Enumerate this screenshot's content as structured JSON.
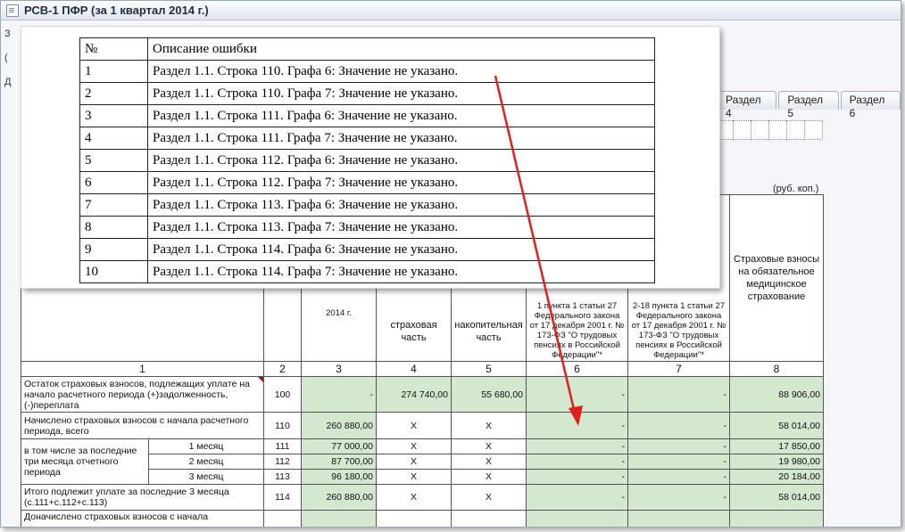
{
  "window": {
    "title": "РСВ-1 ПФР (за 1 квартал 2014 г.)",
    "side_letters": [
      "З",
      "(",
      "Д"
    ]
  },
  "tabs": [
    "Раздел 4",
    "Раздел 5",
    "Раздел 6"
  ],
  "units_label": "(руб. коп.)",
  "table": {
    "headers": {
      "col3": "2014 г.",
      "col4": "страховая часть",
      "col5": "накопительная часть",
      "col6": "1 пункта 1 статьи 27 Федерального закона от 17 декабря 2001 г. № 173-ФЗ \"О трудовых пенсиях в Российской Федерации\"*",
      "col7": "2-18 пункта 1 статьи 27 Федерального закона от 17 декабря 2001 г. № 173-ФЗ \"О трудовых пенсиях в Российской Федерации\"*",
      "col8": "Страховые взносы на обязательное медицинское страхование"
    },
    "col_numbers": [
      "1",
      "2",
      "3",
      "4",
      "5",
      "6",
      "7",
      "8"
    ],
    "row100": {
      "label": "Остаток страховых взносов, подлежащих уплате на начало расчетного периода (+)задолженность, (-)переплата",
      "code": "100",
      "c3": "-",
      "c4": "274 740,00",
      "c5": "55 680,00",
      "c6": "-",
      "c7": "-",
      "c8": "88 906,00"
    },
    "row110": {
      "label": "Начислено страховых взносов с начала расчетного периода, всего",
      "code": "110",
      "c3": "260 880,00",
      "c4": "X",
      "c5": "X",
      "c6": "-",
      "c7": "-",
      "c8": "58 014,00"
    },
    "group_label": "в том числе за последние три месяца отчетного периода",
    "row111": {
      "sub": "1 месяц",
      "code": "111",
      "c3": "77 000,00",
      "c4": "X",
      "c5": "X",
      "c6": "-",
      "c7": "-",
      "c8": "17 850,00"
    },
    "row112": {
      "sub": "2 месяц",
      "code": "112",
      "c3": "87 700,00",
      "c4": "X",
      "c5": "X",
      "c6": "-",
      "c7": "-",
      "c8": "19 980,00"
    },
    "row113": {
      "sub": "3 месяц",
      "code": "113",
      "c3": "96 180,00",
      "c4": "X",
      "c5": "X",
      "c6": "-",
      "c7": "-",
      "c8": "20 184,00"
    },
    "row114": {
      "label": "Итого подлежит уплате за последние 3 месяца (с.111+с.112+с.113)",
      "code": "114",
      "c3": "260 880,00",
      "c4": "X",
      "c5": "X",
      "c6": "-",
      "c7": "-",
      "c8": "58 014,00"
    },
    "row_cut": {
      "label": "Доначислено страховых взносов с начала"
    }
  },
  "errors": {
    "header_no": "№",
    "header_desc": "Описание ошибки",
    "rows": [
      {
        "no": "1",
        "desc": "Раздел 1.1. Строка 110. Графа 6: Значение не указано."
      },
      {
        "no": "2",
        "desc": "Раздел 1.1. Строка 110. Графа 7: Значение не указано."
      },
      {
        "no": "3",
        "desc": "Раздел 1.1. Строка 111. Графа 6: Значение не указано."
      },
      {
        "no": "4",
        "desc": "Раздел 1.1. Строка 111. Графа 7: Значение не указано."
      },
      {
        "no": "5",
        "desc": "Раздел 1.1. Строка 112. Графа 6: Значение не указано."
      },
      {
        "no": "6",
        "desc": "Раздел 1.1. Строка 112. Графа 7: Значение не указано."
      },
      {
        "no": "7",
        "desc": "Раздел 1.1. Строка 113. Графа 6: Значение не указано."
      },
      {
        "no": "8",
        "desc": "Раздел 1.1. Строка 113. Графа 7: Значение не указано."
      },
      {
        "no": "9",
        "desc": "Раздел 1.1. Строка 114. Графа 6: Значение не указано."
      },
      {
        "no": "10",
        "desc": "Раздел 1.1. Строка 114. Графа 7: Значение не указано."
      }
    ]
  },
  "colors": {
    "accent_arrow": "#e0201c",
    "highlight_cell": "#d4e8cf"
  }
}
